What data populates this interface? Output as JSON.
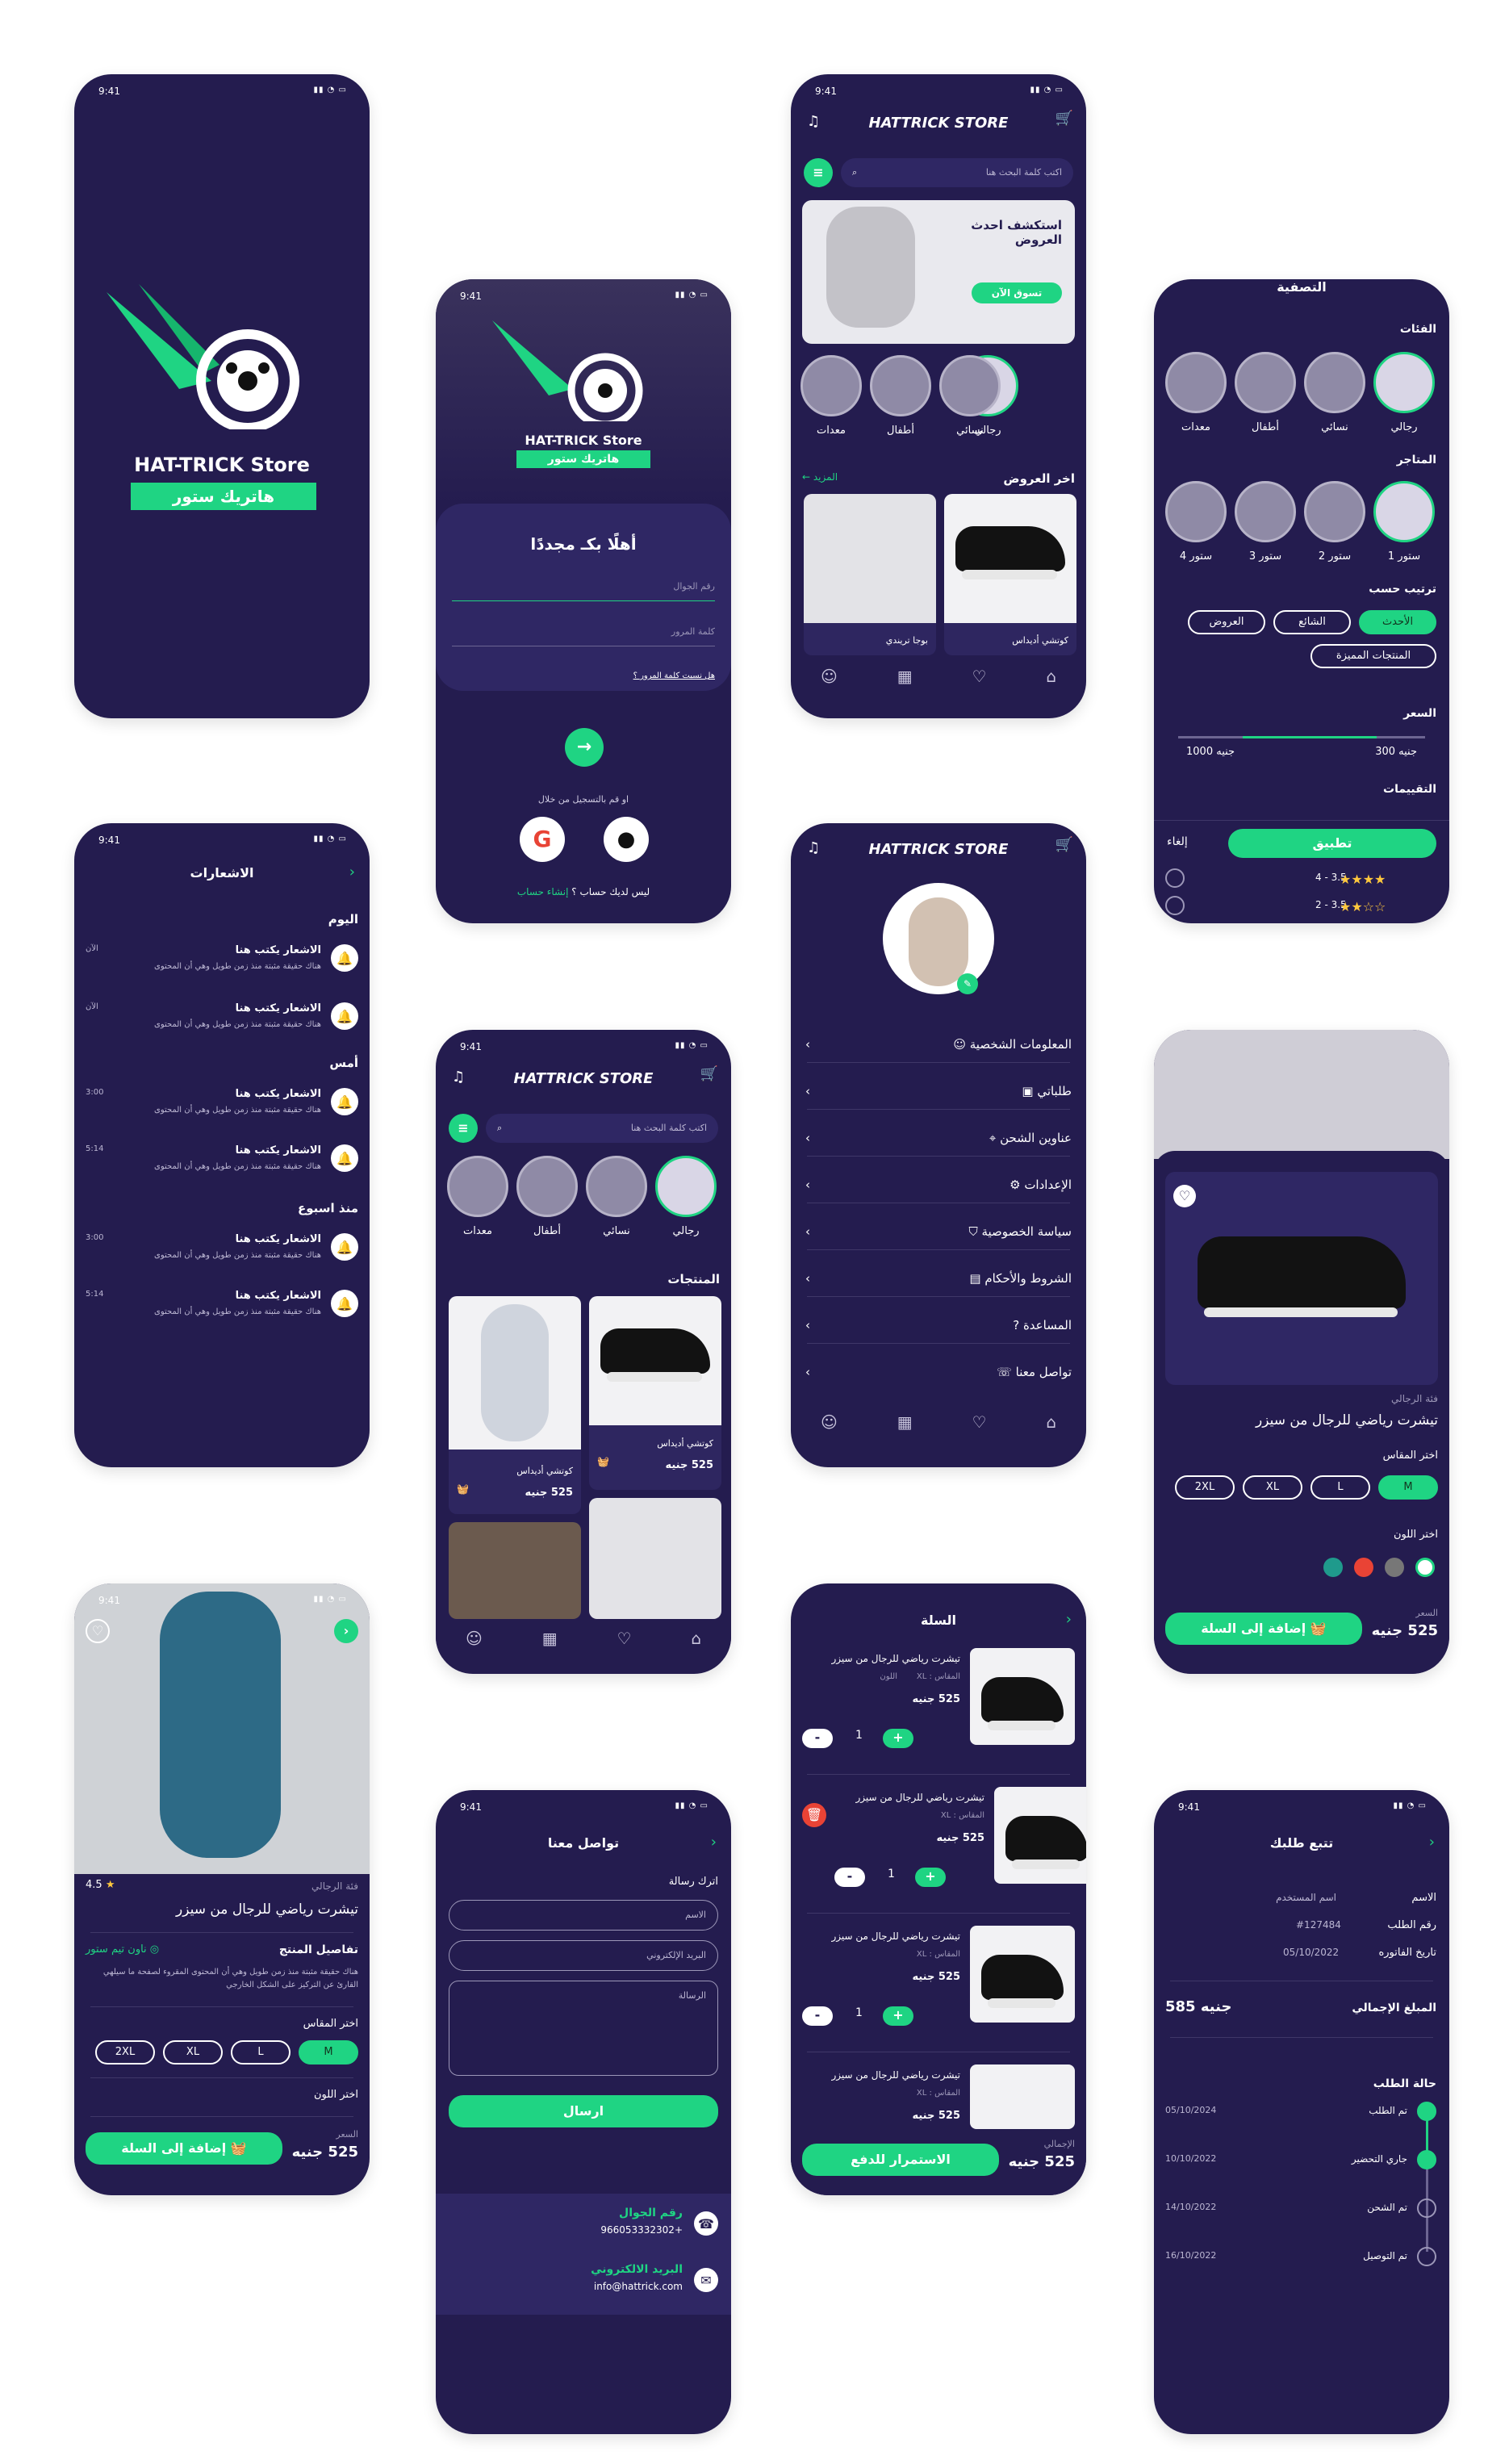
{
  "status_time": "9:41",
  "brand": {
    "en": "HAT-TRICK Store",
    "ar": "هاتريك ستور",
    "header": "HATTRICK STORE"
  },
  "login": {
    "welcome": "أهلًا بكـ مجددًا",
    "phone_placeholder": "رقم الجوال",
    "password_placeholder": "كلمة المرور",
    "forgot": "هل نسيت كلمة المرور ؟",
    "social": "او قم بالتسجيل من خلال",
    "no_account": "ليس لديك حساب ؟",
    "create": "إنشاء حساب"
  },
  "home": {
    "search_placeholder": "اكتب كلمة البحث هنا",
    "banner_title": "استكشف احدث العروض",
    "banner_btn": "تسوق الآن",
    "categories": [
      "رجالي",
      "نسائي",
      "أطفال",
      "معدات"
    ],
    "latest_offers": "اخر العروض",
    "more": "المزيد",
    "offer_items": [
      "كوتشي أديداس",
      "بوجا تريندي"
    ],
    "products_title": "المنتجات",
    "products": [
      {
        "name": "كوتشي أديداس",
        "price": "525 جنيه"
      },
      {
        "name": "كوتشي أديداس",
        "price": "525 جنيه"
      }
    ]
  },
  "filter": {
    "title": "التصفية",
    "cats_title": "الفئات",
    "stores_title": "المتاجر",
    "stores": [
      "ستور 1",
      "ستور 2",
      "ستور 3",
      "ستور 4"
    ],
    "sort_title": "ترتيب حسب",
    "sort": [
      "الأحدث",
      "الشائع",
      "العروض",
      "المنتجات المميزة"
    ],
    "price_title": "السعر",
    "price_min": "300 جنيه",
    "price_max": "1000 جنيه",
    "ratings_title": "التقييمات",
    "rating_rows": [
      "4 - 3.5",
      "2 - 3.5"
    ],
    "apply": "تطبيق",
    "cancel": "إلغاء"
  },
  "notifications": {
    "title": "الاشعارات",
    "today": "اليوم",
    "yesterday": "أمس",
    "week": "منذ اسبوع",
    "item_title": "الاشعار يكتب هنا",
    "item_body": "هناك حقيقة مثبتة منذ زمن طويل وهي أن المحتوى",
    "times": [
      "الآن",
      "الآن",
      "3:00",
      "5:14",
      "3:00",
      "5:14"
    ]
  },
  "profile": {
    "items": [
      "المعلومات الشخصية",
      "طلباتي",
      "عناوين الشحن",
      "الإعدادات",
      "سياسة الخصوصية",
      "الشروط والأحكام",
      "المساعدة",
      "تواصل معنا"
    ]
  },
  "product": {
    "category": "فئة الرجالي",
    "title": "تيشرت رياضي للرجال من سيزر",
    "rating": "4.5",
    "details_title": "تفاصيل المنتج",
    "seller": "ناون تيم ستور",
    "desc": "هناك حقيقة مثبتة منذ زمن طويل وهي أن المحتوى المقروء لصفحة ما سيلهي القارئ عن التركيز على الشكل الخارجي",
    "size_title": "اختر المقاس",
    "sizes": [
      "M",
      "L",
      "XL",
      "2XL"
    ],
    "color_title": "اختر اللون",
    "price_label": "السعر",
    "price": "525 جنيه",
    "add_cart": "إضافة إلى السلة"
  },
  "contact": {
    "title": "تواصل معنا",
    "leave": "اترك رسالة",
    "name": "الاسم",
    "email": "البريد الإلكتروني",
    "message": "الرسالة",
    "send": "ارسال",
    "phone_label": "رقم الجوال",
    "phone": "+966053332302",
    "email_label": "البريد الالكتروني",
    "email_value": "info@hattrick.com"
  },
  "cart": {
    "title": "السلة",
    "item_name": "تيشرت رياضي للرجال من سيزر",
    "size": "المقاس : XL",
    "color": "اللون",
    "price": "525 جنيه",
    "qty": "1",
    "total_label": "الإجمالي",
    "total": "525 جنيه",
    "checkout": "الاستمرار للدفع"
  },
  "track": {
    "title": "تتبع طلبك",
    "name_label": "الاسم",
    "name_value": "اسم المستخدم",
    "order_label": "رقم الطلب",
    "order_value": "#127484",
    "date_label": "تاريخ الفاتوره",
    "date_value": "05/10/2022",
    "total_label": "المبلغ الإجمالي",
    "total_value": "585 جنيه",
    "status_title": "حالة الطلب",
    "steps": [
      {
        "label": "تم الطلب",
        "date": "05/10/2024"
      },
      {
        "label": "جاري التحضير",
        "date": "10/10/2022"
      },
      {
        "label": "تم الشحن",
        "date": "14/10/2022"
      },
      {
        "label": "تم التوصيل",
        "date": "16/10/2022"
      }
    ]
  }
}
